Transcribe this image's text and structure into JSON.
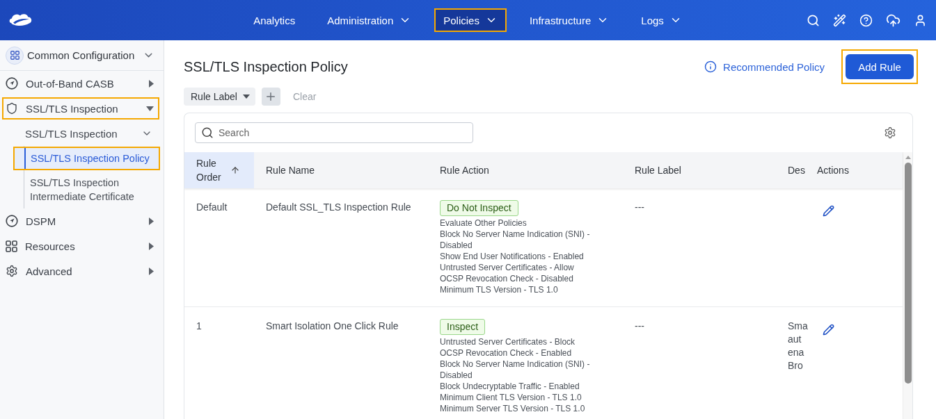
{
  "topbar": {
    "nav": [
      {
        "label": "Analytics",
        "has_menu": false,
        "selected": false,
        "highlighted": false
      },
      {
        "label": "Administration",
        "has_menu": true,
        "selected": false,
        "highlighted": false
      },
      {
        "label": "Policies",
        "has_menu": true,
        "selected": true,
        "highlighted": true
      },
      {
        "label": "Infrastructure",
        "has_menu": true,
        "selected": false,
        "highlighted": false
      },
      {
        "label": "Logs",
        "has_menu": true,
        "selected": false,
        "highlighted": false
      }
    ]
  },
  "sidebar": {
    "header": "Common Configuration",
    "items": [
      {
        "label": "Out-of-Band CASB",
        "expanded": false,
        "selected": false,
        "highlighted": false
      },
      {
        "label": "SSL/TLS Inspection",
        "expanded": true,
        "selected": false,
        "highlighted": true,
        "children": [
          {
            "label": "SSL/TLS Inspection",
            "expanded": true,
            "selected": false,
            "highlighted": false,
            "children": [
              {
                "label": "SSL/TLS Inspection Policy",
                "selected": true,
                "highlighted": true
              },
              {
                "label": "SSL/TLS Inspection Intermediate Certificate",
                "selected": false,
                "highlighted": false
              }
            ]
          }
        ]
      },
      {
        "label": "DSPM",
        "expanded": false,
        "selected": false,
        "highlighted": false
      },
      {
        "label": "Resources",
        "expanded": false,
        "selected": false,
        "highlighted": false
      },
      {
        "label": "Advanced",
        "expanded": false,
        "selected": false,
        "highlighted": false
      }
    ]
  },
  "page": {
    "title": "SSL/TLS Inspection Policy",
    "recommended_link": "Recommended Policy",
    "add_button": {
      "label": "Add Rule",
      "highlighted": true
    }
  },
  "filters": {
    "chip": "Rule Label",
    "clear": "Clear"
  },
  "table": {
    "search": {
      "placeholder": "Search"
    },
    "columns": [
      {
        "label": "Rule Order",
        "sorted": true
      },
      {
        "label": "Rule Name",
        "sorted": false
      },
      {
        "label": "Rule Action",
        "sorted": false
      },
      {
        "label": "Rule Label",
        "sorted": false
      },
      {
        "label": "Des",
        "sorted": false
      },
      {
        "label": "Actions",
        "sorted": false
      }
    ],
    "rows": [
      {
        "rule_order": "Default",
        "rule_name": "Default SSL_TLS Inspection Rule",
        "action": {
          "label": "Do Not Inspect",
          "details": [
            "Evaluate Other Policies",
            "Block No Server Name Indication (SNI) - Disabled",
            "Show End User Notifications - Enabled",
            "Untrusted Server Certificates - Allow",
            "OCSP Revocation Check - Disabled",
            "Minimum TLS Version - TLS 1.0"
          ]
        },
        "rule_label": "---"
      },
      {
        "rule_order": "1",
        "rule_name": "Smart Isolation One Click Rule",
        "action": {
          "label": "Inspect",
          "details": [
            "Untrusted Server Certificates - Block",
            "OCSP Revocation Check - Enabled",
            "Block No Server Name Indication (SNI) - Disabled",
            "Block Undecryptable Traffic - Enabled",
            "Minimum Client TLS Version - TLS 1.0",
            "Minimum Server TLS Version - TLS 1.0"
          ]
        },
        "rule_label": "---",
        "description": [
          "Sma",
          "aut",
          "ena",
          "Bro"
        ]
      }
    ]
  }
}
